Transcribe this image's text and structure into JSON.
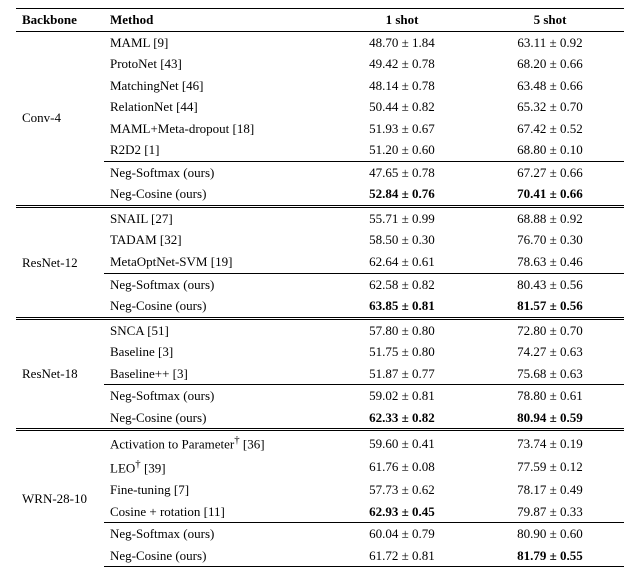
{
  "header": {
    "backbone": "Backbone",
    "method": "Method",
    "shot1": "1 shot",
    "shot5": "5 shot"
  },
  "groups": [
    {
      "backbone": "Conv-4",
      "rows": [
        {
          "method": "MAML [9]",
          "s1": "48.70 ± 1.84",
          "s5": "63.11 ± 0.92",
          "bold": false,
          "sub": false
        },
        {
          "method": "ProtoNet [43]",
          "s1": "49.42 ± 0.78",
          "s5": "68.20 ± 0.66",
          "bold": false,
          "sub": false
        },
        {
          "method": "MatchingNet [46]",
          "s1": "48.14 ± 0.78",
          "s5": "63.48 ± 0.66",
          "bold": false,
          "sub": false
        },
        {
          "method": "RelationNet [44]",
          "s1": "50.44 ± 0.82",
          "s5": "65.32 ± 0.70",
          "bold": false,
          "sub": false
        },
        {
          "method": "MAML+Meta-dropout [18]",
          "s1": "51.93 ± 0.67",
          "s5": "67.42 ± 0.52",
          "bold": false,
          "sub": false
        },
        {
          "method": "R2D2 [1]",
          "s1": "51.20 ± 0.60",
          "s5": "68.80 ± 0.10",
          "bold": false,
          "sub": false
        },
        {
          "method": "Neg-Softmax (ours)",
          "s1": "47.65 ± 0.78",
          "s5": "67.27 ± 0.66",
          "bold": false,
          "sub": true
        },
        {
          "method": "Neg-Cosine (ours)",
          "s1": "52.84 ± 0.76",
          "s5": "70.41 ± 0.66",
          "bold": true,
          "sub": false
        }
      ]
    },
    {
      "backbone": "ResNet-12",
      "rows": [
        {
          "method": "SNAIL [27]",
          "s1": "55.71 ± 0.99",
          "s5": "68.88 ± 0.92",
          "bold": false,
          "sub": false
        },
        {
          "method": "TADAM [32]",
          "s1": "58.50 ± 0.30",
          "s5": "76.70 ± 0.30",
          "bold": false,
          "sub": false
        },
        {
          "method": "MetaOptNet-SVM [19]",
          "s1": "62.64 ± 0.61",
          "s5": "78.63 ± 0.46",
          "bold": false,
          "sub": false
        },
        {
          "method": "Neg-Softmax (ours)",
          "s1": "62.58 ± 0.82",
          "s5": "80.43 ± 0.56",
          "bold": false,
          "sub": true
        },
        {
          "method": "Neg-Cosine (ours)",
          "s1": "63.85 ± 0.81",
          "s5": "81.57 ± 0.56",
          "bold": true,
          "sub": false
        }
      ]
    },
    {
      "backbone": "ResNet-18",
      "rows": [
        {
          "method": "SNCA [51]",
          "s1": "57.80 ± 0.80",
          "s5": "72.80 ± 0.70",
          "bold": false,
          "sub": false
        },
        {
          "method": "Baseline [3]",
          "s1": "51.75 ± 0.80",
          "s5": "74.27 ± 0.63",
          "bold": false,
          "sub": false
        },
        {
          "method": "Baseline++ [3]",
          "s1": "51.87 ± 0.77",
          "s5": "75.68 ± 0.63",
          "bold": false,
          "sub": false
        },
        {
          "method": "Neg-Softmax (ours)",
          "s1": "59.02 ± 0.81",
          "s5": "78.80 ± 0.61",
          "bold": false,
          "sub": true
        },
        {
          "method": "Neg-Cosine (ours)",
          "s1": "62.33 ± 0.82",
          "s5": "80.94 ± 0.59",
          "bold": true,
          "sub": false
        }
      ]
    },
    {
      "backbone": "WRN-28-10",
      "rows": [
        {
          "method": "Activation to Parameter† [36]",
          "s1": "59.60 ± 0.41",
          "s5": "73.74 ± 0.19",
          "bold": false,
          "sub": false
        },
        {
          "method": "LEO† [39]",
          "s1": "61.76 ± 0.08",
          "s5": "77.59 ± 0.12",
          "bold": false,
          "sub": false
        },
        {
          "method": "Fine-tuning [7]",
          "s1": "57.73 ± 0.62",
          "s5": "78.17 ± 0.49",
          "bold": false,
          "sub": false
        },
        {
          "method": "Cosine + rotation [11]",
          "s1": "62.93 ± 0.45",
          "s5": "79.87 ± 0.33",
          "bold": false,
          "sub": false,
          "bold_s1_only": true
        },
        {
          "method": "Neg-Softmax (ours)",
          "s1": "60.04 ± 0.79",
          "s5": "80.90 ± 0.60",
          "bold": false,
          "sub": true
        },
        {
          "method": "Neg-Cosine (ours)",
          "s1": "61.72 ± 0.81",
          "s5": "81.79 ± 0.55",
          "bold": false,
          "sub": false,
          "bold_s5_only": true
        }
      ]
    }
  ],
  "chart_data": {
    "type": "table",
    "title": "Few-shot classification accuracy (mean ± 95% CI)",
    "columns": [
      "Backbone",
      "Method",
      "1 shot",
      "5 shot"
    ],
    "rows": [
      [
        "Conv-4",
        "MAML [9]",
        "48.70 ± 1.84",
        "63.11 ± 0.92"
      ],
      [
        "Conv-4",
        "ProtoNet [43]",
        "49.42 ± 0.78",
        "68.20 ± 0.66"
      ],
      [
        "Conv-4",
        "MatchingNet [46]",
        "48.14 ± 0.78",
        "63.48 ± 0.66"
      ],
      [
        "Conv-4",
        "RelationNet [44]",
        "50.44 ± 0.82",
        "65.32 ± 0.70"
      ],
      [
        "Conv-4",
        "MAML+Meta-dropout [18]",
        "51.93 ± 0.67",
        "67.42 ± 0.52"
      ],
      [
        "Conv-4",
        "R2D2 [1]",
        "51.20 ± 0.60",
        "68.80 ± 0.10"
      ],
      [
        "Conv-4",
        "Neg-Softmax (ours)",
        "47.65 ± 0.78",
        "67.27 ± 0.66"
      ],
      [
        "Conv-4",
        "Neg-Cosine (ours)",
        "52.84 ± 0.76",
        "70.41 ± 0.66"
      ],
      [
        "ResNet-12",
        "SNAIL [27]",
        "55.71 ± 0.99",
        "68.88 ± 0.92"
      ],
      [
        "ResNet-12",
        "TADAM [32]",
        "58.50 ± 0.30",
        "76.70 ± 0.30"
      ],
      [
        "ResNet-12",
        "MetaOptNet-SVM [19]",
        "62.64 ± 0.61",
        "78.63 ± 0.46"
      ],
      [
        "ResNet-12",
        "Neg-Softmax (ours)",
        "62.58 ± 0.82",
        "80.43 ± 0.56"
      ],
      [
        "ResNet-12",
        "Neg-Cosine (ours)",
        "63.85 ± 0.81",
        "81.57 ± 0.56"
      ],
      [
        "ResNet-18",
        "SNCA [51]",
        "57.80 ± 0.80",
        "72.80 ± 0.70"
      ],
      [
        "ResNet-18",
        "Baseline [3]",
        "51.75 ± 0.80",
        "74.27 ± 0.63"
      ],
      [
        "ResNet-18",
        "Baseline++ [3]",
        "51.87 ± 0.77",
        "75.68 ± 0.63"
      ],
      [
        "ResNet-18",
        "Neg-Softmax (ours)",
        "59.02 ± 0.81",
        "78.80 ± 0.61"
      ],
      [
        "ResNet-18",
        "Neg-Cosine (ours)",
        "62.33 ± 0.82",
        "80.94 ± 0.59"
      ],
      [
        "WRN-28-10",
        "Activation to Parameter† [36]",
        "59.60 ± 0.41",
        "73.74 ± 0.19"
      ],
      [
        "WRN-28-10",
        "LEO† [39]",
        "61.76 ± 0.08",
        "77.59 ± 0.12"
      ],
      [
        "WRN-28-10",
        "Fine-tuning [7]",
        "57.73 ± 0.62",
        "78.17 ± 0.49"
      ],
      [
        "WRN-28-10",
        "Cosine + rotation [11]",
        "62.93 ± 0.45",
        "79.87 ± 0.33"
      ],
      [
        "WRN-28-10",
        "Neg-Softmax (ours)",
        "60.04 ± 0.79",
        "80.90 ± 0.60"
      ],
      [
        "WRN-28-10",
        "Neg-Cosine (ours)",
        "61.72 ± 0.81",
        "81.79 ± 0.55"
      ]
    ]
  }
}
